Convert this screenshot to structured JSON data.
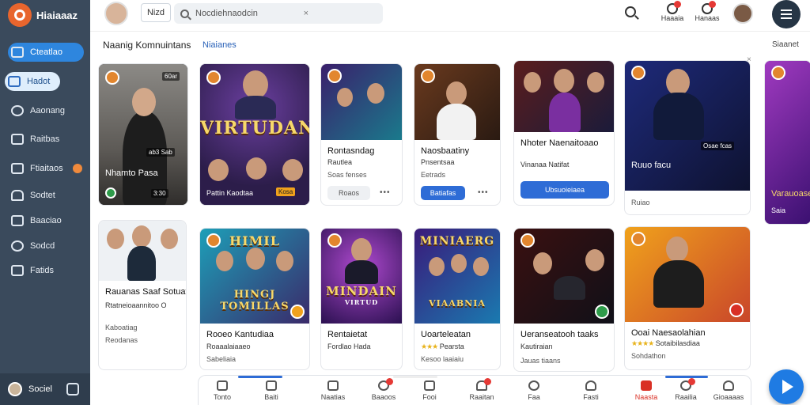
{
  "app": {
    "brand": "Hiaiaaaz"
  },
  "sidebar": {
    "items": [
      {
        "label": "Cteatlao",
        "icon": "home-icon",
        "state": "active"
      },
      {
        "label": "Hadot",
        "icon": "person-icon",
        "state": "alt"
      },
      {
        "label": "Aaonang",
        "icon": "compass-icon"
      },
      {
        "label": "Raitbas",
        "icon": "grid-icon"
      },
      {
        "label": "Ftiaitaos",
        "icon": "list-icon",
        "badge": true
      },
      {
        "label": "Sodtet",
        "icon": "bell-icon"
      },
      {
        "label": "Baaciao",
        "icon": "calendar-icon"
      },
      {
        "label": "Sodcd",
        "icon": "settings-icon"
      },
      {
        "label": "Fatids",
        "icon": "folder-icon"
      }
    ],
    "footer": {
      "label": "Sociel"
    }
  },
  "topbar": {
    "search_scope": "Nizd",
    "search_placeholder": "Nocdiehnaodcin",
    "search_clear": "×",
    "actions": [
      {
        "label": "Haaaia",
        "icon": "notification-icon"
      },
      {
        "label": "Hanaas",
        "icon": "person-alert-icon"
      }
    ]
  },
  "section": {
    "title": "Naanig Komnuintans",
    "link": "Niaianes",
    "more": "Siaanet",
    "close": "×"
  },
  "cards_row1": [
    {
      "name": "Nhamto Pasa",
      "tag": "60ar",
      "time": "ab3 Sab",
      "meta": "3:30"
    },
    {
      "name": "VIRTUDAN",
      "sub": "Pattin Kaodtaa",
      "meta": "Kosa"
    },
    {
      "title": "Rontasndag",
      "sub": "Rautlea",
      "meta": "Soas fenses",
      "btn": "Roaos",
      "dots": "•••"
    },
    {
      "title": "Naosbaatiny",
      "sub": "Pnsentsaa",
      "meta": "Eetrads",
      "btn": "Batiafas",
      "dots": "•••"
    },
    {
      "title": "Nhoter Naenaitoaao",
      "sub": "Vinanaa Natifat",
      "btn": "Ubsuoieiaea"
    },
    {
      "title": "Ruuo facu",
      "tag": "Osae fcas",
      "meta": "Ruiao"
    },
    {
      "title": "Varauoasea",
      "meta": "Saia"
    }
  ],
  "cards_row2": [
    {
      "title": "Rauanas Saaf Sotuat",
      "sub": "Rtatneioaannitoo O",
      "meta": "Kaboatiag",
      "meta2": "Reodanas"
    },
    {
      "title": "Rooeo Kantudiaa",
      "sub": "Roaaalaiaaeo",
      "meta": "Sabeliaia",
      "poster": "HINGJ TOMILLAS",
      "poster_top": "HIMIL"
    },
    {
      "title": "Rentaietat",
      "sub": "Fordlao Hada",
      "poster": "MINDAIN",
      "poster_sub": "VIRTUD"
    },
    {
      "title": "Uoarteleatan",
      "sub": "Pearsta",
      "meta": "Kesoo laaiaiu",
      "poster": "MINIAERG",
      "poster_sub": "VIAABNIA"
    },
    {
      "title": "Ueranseatooh taaks",
      "sub": "Kautiraian",
      "meta": "Jauas tiaans"
    },
    {
      "title": "Ooai Naesaolahian",
      "sub": "Sotaibilasdiaa",
      "meta": "Sohdathon"
    }
  ],
  "tabbar": {
    "tabs": [
      {
        "label": "Tonto",
        "icon": "home-tab-icon"
      },
      {
        "label": "Baiti",
        "icon": "grid-tab-icon"
      },
      {
        "label": "Naatias",
        "icon": "bookmark-tab-icon"
      },
      {
        "label": "Baaoos",
        "icon": "chat-tab-icon",
        "badge": true
      },
      {
        "label": "Fooi",
        "icon": "calendar-tab-icon"
      },
      {
        "label": "Raaitan",
        "icon": "bell-tab-icon",
        "badge": true
      },
      {
        "label": "Faa",
        "icon": "refresh-tab-icon"
      },
      {
        "label": "Fasti",
        "icon": "user-tab-icon"
      },
      {
        "label": "Naasta",
        "icon": "store-tab-icon",
        "state": "active"
      },
      {
        "label": "Raailia",
        "icon": "comment-tab-icon",
        "badge": true
      },
      {
        "label": "Gioaaaas",
        "icon": "account-tab-icon"
      }
    ]
  },
  "colors": {
    "sidebar": "#3a4a5c",
    "accent": "#2e86de",
    "button_blue": "#2e6cd6",
    "badge_red": "#e53935",
    "star": "#e8b31c"
  }
}
